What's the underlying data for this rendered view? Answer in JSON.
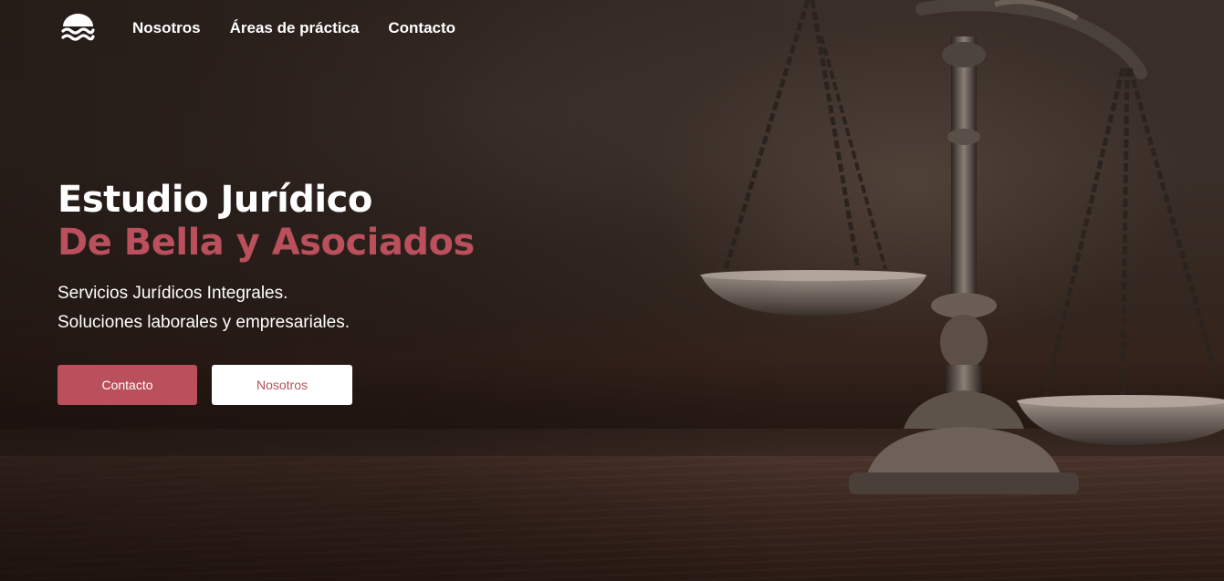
{
  "nav": {
    "logo_icon": "waves-icon",
    "links": [
      "Nosotros",
      "Áreas de práctica",
      "Contacto"
    ]
  },
  "hero": {
    "title_line1": "Estudio Jurídico",
    "title_line2": "De Bella y Asociados",
    "subtitle_line1": "Servicios Jurídicos Integrales.",
    "subtitle_line2": "Soluciones laborales y empresariales.",
    "primary_button": "Contacto",
    "secondary_button": "Nosotros",
    "background_image": "scales-of-justice"
  },
  "colors": {
    "accent": "#b9505b",
    "text": "#ffffff"
  }
}
